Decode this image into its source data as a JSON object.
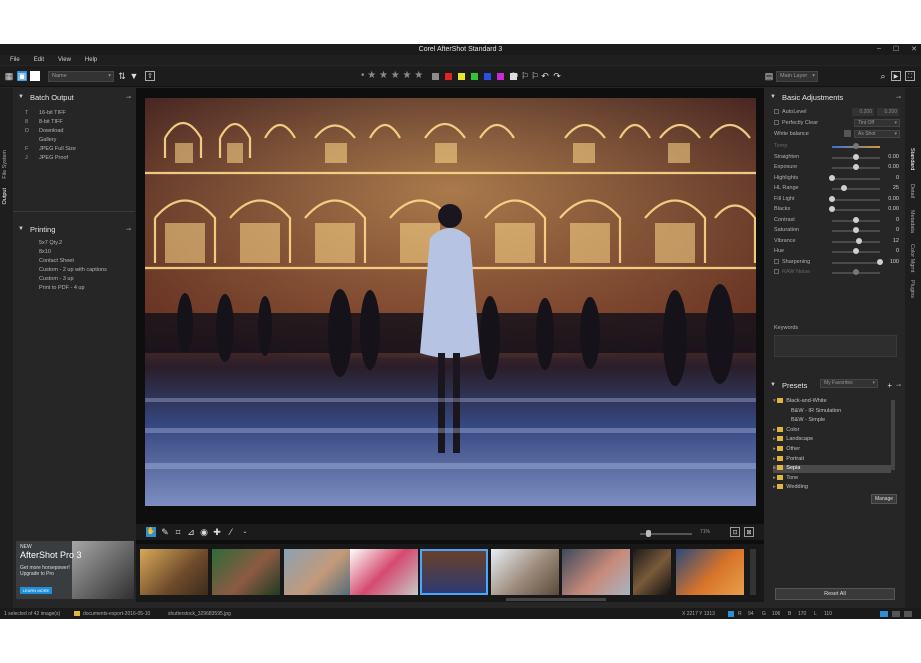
{
  "window": {
    "title": "Corel AfterShot Standard 3"
  },
  "menu": [
    "File",
    "Edit",
    "View",
    "Help"
  ],
  "toolbar": {
    "sort_value": "Name",
    "layer_value": "Main Layer",
    "stars": "• ★ ★ ★ ★ ★",
    "color_labels": [
      "#8c8c8c",
      "#e02424",
      "#e8e82a",
      "#35c435",
      "#2a4ee8",
      "#c82ad6",
      "#dddddd"
    ]
  },
  "left_tabs": {
    "file_system": "File System",
    "output": "Output"
  },
  "batch_output": {
    "title": "Batch Output",
    "items": [
      {
        "key": "T",
        "label": "16-bit TIFF"
      },
      {
        "key": "8",
        "label": "8-bit TIFF"
      },
      {
        "key": "D",
        "label": "Download"
      },
      {
        "key": "",
        "label": "Gallery"
      },
      {
        "key": "F",
        "label": "JPEG Full Size"
      },
      {
        "key": "J",
        "label": "JPEG Proof"
      }
    ]
  },
  "printing": {
    "title": "Printing",
    "items": [
      "5x7 Qty.2",
      "8x10",
      "Contact Sheet",
      "Custom - 2 up with captions",
      "Custom - 3 up",
      "Print to PDF - 4 up"
    ]
  },
  "ad": {
    "new": "NEW",
    "product": "AfterShot Pro 3",
    "line1": "Get more horsepower!",
    "line2": "Upgrade to Pro",
    "button": "LEARN MORE"
  },
  "viewer": {
    "zoom": "71%"
  },
  "basic_adjustments": {
    "title": "Basic Adjustments",
    "autolevel": {
      "label": "AutoLevel",
      "v1": "0.200",
      "v2": "0.200"
    },
    "perfectly_clear": {
      "label": "Perfectly Clear",
      "value": "Tint Off"
    },
    "white_balance": {
      "label": "White balance",
      "value": "As Shot"
    },
    "sliders": [
      {
        "label": "Temp",
        "value": "",
        "pos": 0.5
      },
      {
        "label": "Straighten",
        "value": "0.00",
        "pos": 0.5
      },
      {
        "label": "Exposure",
        "value": "0.00",
        "pos": 0.5
      },
      {
        "label": "Highlights",
        "value": "0",
        "pos": 0.0
      },
      {
        "label": "HL Range",
        "value": "25",
        "pos": 0.25
      },
      {
        "label": "Fill Light",
        "value": "0.00",
        "pos": 0.0
      },
      {
        "label": "Blacks",
        "value": "0.00",
        "pos": 0.0
      },
      {
        "label": "Contrast",
        "value": "0",
        "pos": 0.5
      },
      {
        "label": "Saturation",
        "value": "0",
        "pos": 0.5
      },
      {
        "label": "Vibrance",
        "value": "12",
        "pos": 0.56
      },
      {
        "label": "Hue",
        "value": "0",
        "pos": 0.5
      },
      {
        "label": "Sharpening",
        "value": "100",
        "pos": 1.0
      },
      {
        "label": "RAW Noise",
        "value": "",
        "pos": 0.5
      }
    ],
    "keywords": "Keywords"
  },
  "presets": {
    "title": "Presets",
    "filter": "My Favorites",
    "items": [
      {
        "label": "Black-and-White",
        "folder": true,
        "indent": 0,
        "open": true
      },
      {
        "label": "B&W - IR Simulation",
        "folder": false,
        "indent": 1
      },
      {
        "label": "B&W - Simple",
        "folder": false,
        "indent": 1
      },
      {
        "label": "Color",
        "folder": true,
        "indent": 0
      },
      {
        "label": "Landscape",
        "folder": true,
        "indent": 0
      },
      {
        "label": "Other",
        "folder": true,
        "indent": 0
      },
      {
        "label": "Portrait",
        "folder": true,
        "indent": 0
      },
      {
        "label": "Sepia",
        "folder": true,
        "indent": 0,
        "selected": true
      },
      {
        "label": "Tone",
        "folder": true,
        "indent": 0
      },
      {
        "label": "Wedding",
        "folder": true,
        "indent": 0
      }
    ],
    "manage": "Manage"
  },
  "right_tabs": [
    "Standard",
    "Detail",
    "Metadata",
    "Color Mgmt",
    "Plugins"
  ],
  "reset_all": "Reset All",
  "status": {
    "selection": "1 selected of 42 image(s)",
    "folder": "documents-export-2016-05-10",
    "file": "shutterstock_329683595.jpg",
    "coords": "X 2217  Y 1313",
    "r": "94",
    "g": "106",
    "b": "170",
    "l": "110"
  }
}
